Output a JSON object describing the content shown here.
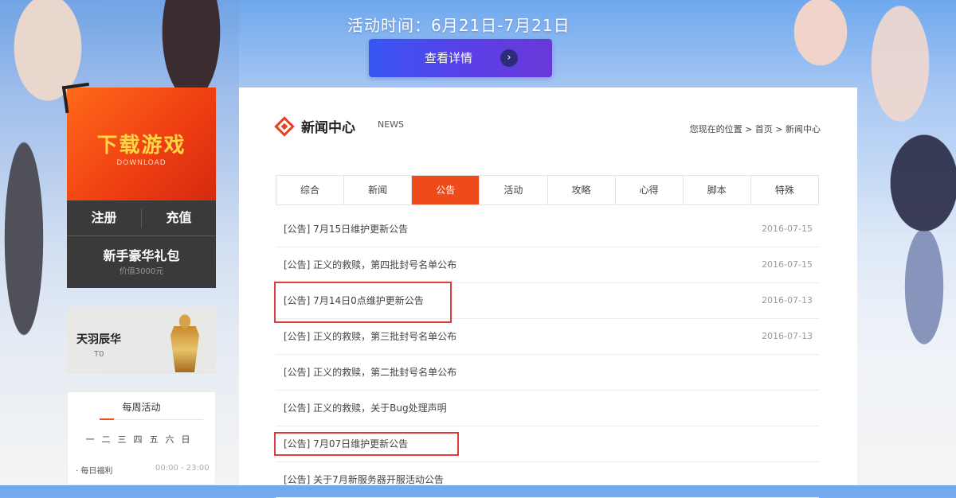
{
  "banner": {
    "event_time": "活动时间：6月21日-7月21日",
    "details_label": "查看详情",
    "details_arrow": "›"
  },
  "sidebar": {
    "download_title": "下载游戏",
    "download_sub": "DOWNLOAD",
    "register": "注册",
    "recharge": "充值",
    "gift_title": "新手豪华礼包",
    "gift_sub": "价值3000元",
    "promo_title": "天羽辰华",
    "promo_sub": "T0",
    "weekly_title": "每周活动",
    "weekdays": [
      "一",
      "二",
      "三",
      "四",
      "五",
      "六",
      "日"
    ],
    "weekly_item": "· 每日福利",
    "weekly_time": "00:00 - 23:00"
  },
  "news": {
    "title": "新闻中心",
    "title_en": "NEWS",
    "breadcrumb": "您现在的位置 > 首页 > 新闻中心",
    "tabs": [
      "综合",
      "新闻",
      "公告",
      "活动",
      "攻略",
      "心得",
      "脚本",
      "特殊"
    ],
    "active_tab": 2,
    "items": [
      {
        "text": "[公告] 7月15日维护更新公告",
        "date": "2016-07-15"
      },
      {
        "text": "[公告] 正义的救赎，第四批封号名单公布",
        "date": "2016-07-15"
      },
      {
        "text": "[公告] 7月14日0点维护更新公告",
        "date": "2016-07-13"
      },
      {
        "text": "[公告] 正义的救赎，第三批封号名单公布",
        "date": "2016-07-13"
      },
      {
        "text": "[公告] 正义的救赎，第二批封号名单公布",
        "date": ""
      },
      {
        "text": "[公告] 正义的救赎，关于Bug处理声明",
        "date": ""
      },
      {
        "text": "[公告] 7月07日维护更新公告",
        "date": ""
      },
      {
        "text": "[公告] 关于7月新服务器开服活动公告",
        "date": ""
      }
    ]
  },
  "colors": {
    "accent": "#ef4a19",
    "highlight": "#e23b3b",
    "button_gradient_start": "#3856f5",
    "button_gradient_end": "#6a38d8"
  }
}
